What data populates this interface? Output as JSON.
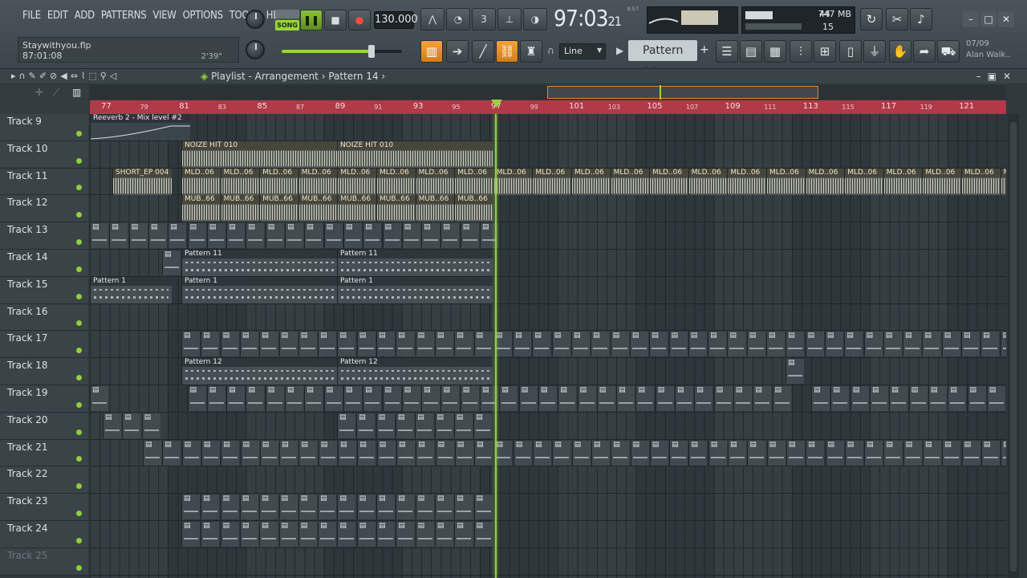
{
  "menu": [
    "FILE",
    "EDIT",
    "ADD",
    "PATTERNS",
    "VIEW",
    "OPTIONS",
    "TOOLS",
    "HELP"
  ],
  "transport": {
    "song_label": "SONG",
    "tempo": "130.000",
    "time": "97:03",
    "time_sub": "21",
    "time_format": "B:S:T"
  },
  "cpu": {
    "value": "44",
    "memory": "747 MB",
    "polyphony": "15"
  },
  "hint": {
    "file": "Staywithyou.flp",
    "position": "87:01:08",
    "length": "2'39\""
  },
  "snap": "Line",
  "pattern_selector": "Pattern 14",
  "news": {
    "date": "07/09",
    "author": "Alan Walk.."
  },
  "playlist": {
    "title": "Playlist - Arrangement",
    "pattern": "Pattern 14"
  },
  "ruler": [
    "77",
    "79",
    "81",
    "83",
    "85",
    "87",
    "89",
    "91",
    "93",
    "95",
    "97",
    "99",
    "101",
    "103",
    "105",
    "107",
    "109",
    "111",
    "113",
    "115",
    "117",
    "119",
    "121"
  ],
  "tracks": [
    "Track 9",
    "Track 10",
    "Track 11",
    "Track 12",
    "Track 13",
    "Track 14",
    "Track 15",
    "Track 16",
    "Track 17",
    "Track 18",
    "Track 19",
    "Track 20",
    "Track 21",
    "Track 22",
    "Track 23",
    "Track 24",
    "Track 25"
  ],
  "clips": {
    "reverb": "Reeverb 2 - Mix level #2",
    "noize1": "NOIZE HIT 010",
    "noize2": "NOIZE HIT 010",
    "short": "SHORT_EP 004",
    "mld": "MLD..06",
    "mub": "MUB..66",
    "mu": "MU..66",
    "p11a": "Pattern 11",
    "p11b": "Pattern 11",
    "p1a": "Pattern 1",
    "p1b": "Pattern 1",
    "p1c": "Pattern 1",
    "p12a": "Pattern 12",
    "p12b": "Pattern 12"
  },
  "colors": {
    "accent_green": "#9ad33e",
    "ruler": "#b03a48",
    "orange": "#e8932a"
  }
}
